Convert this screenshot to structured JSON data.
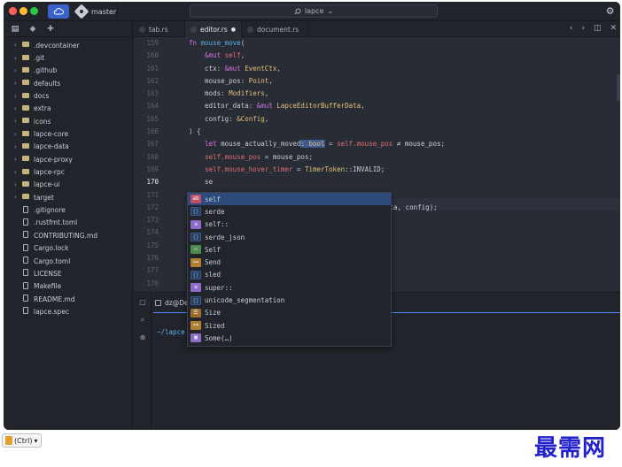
{
  "titlebar": {
    "branch": "master",
    "search_text": "lapce",
    "search_chevron": "⌄"
  },
  "sidebar": {
    "tabs": [
      "files-icon",
      "git-icon",
      "plugins-icon"
    ],
    "items": [
      {
        "label": ".devcontainer",
        "type": "folder"
      },
      {
        "label": ".git",
        "type": "folder"
      },
      {
        "label": ".github",
        "type": "folder"
      },
      {
        "label": "defaults",
        "type": "folder"
      },
      {
        "label": "docs",
        "type": "folder"
      },
      {
        "label": "extra",
        "type": "folder"
      },
      {
        "label": "icons",
        "type": "folder"
      },
      {
        "label": "lapce-core",
        "type": "folder"
      },
      {
        "label": "lapce-data",
        "type": "folder"
      },
      {
        "label": "lapce-proxy",
        "type": "folder"
      },
      {
        "label": "lapce-rpc",
        "type": "folder"
      },
      {
        "label": "lapce-ui",
        "type": "folder"
      },
      {
        "label": "target",
        "type": "folder"
      },
      {
        "label": ".gitignore",
        "type": "file"
      },
      {
        "label": ".rustfmt.toml",
        "type": "file"
      },
      {
        "label": "CONTRIBUTING.md",
        "type": "file"
      },
      {
        "label": "Cargo.lock",
        "type": "file"
      },
      {
        "label": "Cargo.toml",
        "type": "file"
      },
      {
        "label": "LICENSE",
        "type": "file"
      },
      {
        "label": "Makefile",
        "type": "file"
      },
      {
        "label": "README.md",
        "type": "file"
      },
      {
        "label": "lapce.spec",
        "type": "file"
      }
    ]
  },
  "tabs": [
    {
      "label": "tab.rs",
      "active": false
    },
    {
      "label": "editor.rs",
      "active": true,
      "modified_marker": "●"
    },
    {
      "label": "document.rs",
      "active": false
    }
  ],
  "tab_controls": [
    "‹",
    "›",
    "◫",
    "✕"
  ],
  "editor": {
    "line_numbers": [
      "159",
      "160",
      "161",
      "162",
      "163",
      "164",
      "165",
      "166",
      "167",
      "168",
      "169",
      "170",
      "171",
      "172",
      "173",
      "174",
      "175",
      "176",
      "177",
      "178"
    ],
    "current_line": "170",
    "lines": {
      "l159a": "fn ",
      "l159b": "mouse_move",
      "l159c": "(",
      "l160a": "    &mut ",
      "l160b": "self",
      "l160c": ",",
      "l161a": "    ctx: ",
      "l161b": "&mut ",
      "l161c": "EventCtx",
      "l161d": ",",
      "l162a": "    mouse_pos: ",
      "l162b": "Point",
      "l162c": ",",
      "l163a": "    mods: ",
      "l163b": "Modifiers",
      "l163c": ",",
      "l164a": "    editor_data: ",
      "l164b": "&mut ",
      "l164c": "LapceEditorBufferData",
      "l164d": ",",
      "l165a": "    config: ",
      "l165b": "&Config",
      "l165c": ",",
      "l166a": ") {",
      "l167a": "    ",
      "l167b": "let ",
      "l167c": "mouse_actually_moved",
      "l167d": ": bool",
      "l167e": " = ",
      "l167f": "self",
      "l167g": ".mouse_pos",
      "l167h": " ≠ mouse_pos;",
      "l168a": "    ",
      "l168b": "self",
      "l168c": ".mouse_pos",
      "l168d": " = mouse_pos;",
      "l169a": "    ",
      "l169b": "self",
      "l169c": ".mouse_hover_timer",
      "l169d": " = ",
      "l169e": "TimerToken",
      "l169f": "::INVALID;",
      "l170a": "    se",
      "l172tail": "ata, config);"
    }
  },
  "completion": {
    "items": [
      {
        "label": "self",
        "kind": "kw",
        "glyph": "ab"
      },
      {
        "label": "serde",
        "kind": "mod",
        "glyph": "{}"
      },
      {
        "label": "self::",
        "kind": "struct",
        "glyph": "≡"
      },
      {
        "label": "serde_json",
        "kind": "mod",
        "glyph": "{}"
      },
      {
        "label": "Self",
        "kind": "type",
        "glyph": "▭"
      },
      {
        "label": "Send",
        "kind": "fn",
        "glyph": "⊶"
      },
      {
        "label": "sled",
        "kind": "mod",
        "glyph": "{}"
      },
      {
        "label": "super::",
        "kind": "struct",
        "glyph": "≡"
      },
      {
        "label": "unicode_segmentation",
        "kind": "mod",
        "glyph": "{}"
      },
      {
        "label": "Size",
        "kind": "enum",
        "glyph": "☰"
      },
      {
        "label": "Sized",
        "kind": "fn",
        "glyph": "⊶"
      },
      {
        "label": "Some(…)",
        "kind": "struct",
        "glyph": "▦"
      }
    ]
  },
  "panel": {
    "terminal_tab": "dz@De",
    "prompt": "~/lapce"
  },
  "bottom": {
    "ime_label": "(Ctrl)",
    "ime_chevron": "▾",
    "brand": "最需网"
  }
}
